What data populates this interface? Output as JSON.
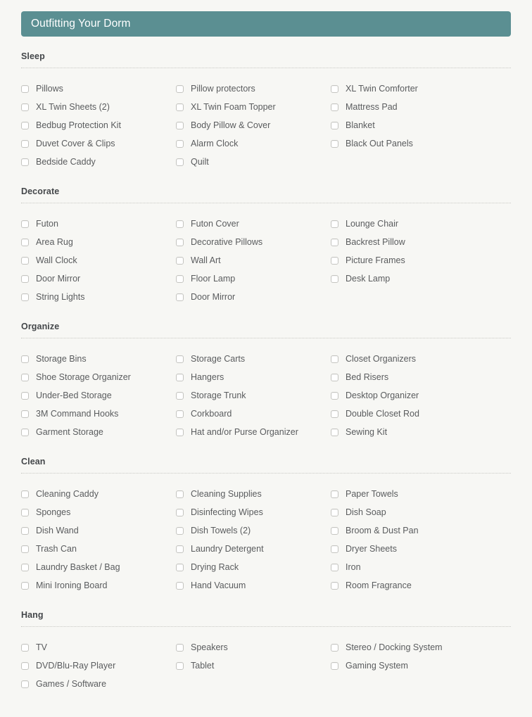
{
  "header": {
    "title": "Outfitting Your Dorm",
    "accent_color": "#5b8f92",
    "text_color": "#ffffff"
  },
  "page": {
    "background_color": "#f7f7f4",
    "label_color": "#5a5c5e",
    "section_heading_color": "#44474a",
    "checkbox_border_color": "#c4c4c0",
    "divider_color": "#c9c9c4"
  },
  "sections": [
    {
      "heading": "Sleep",
      "columns": [
        [
          "Pillows",
          "XL Twin Sheets (2)",
          "Bedbug Protection Kit",
          "Duvet Cover & Clips",
          "Bedside Caddy"
        ],
        [
          "Pillow protectors",
          "XL Twin Foam Topper",
          "Body Pillow & Cover",
          "Alarm Clock",
          "Quilt"
        ],
        [
          "XL Twin Comforter",
          "Mattress Pad",
          "Blanket",
          "Black Out Panels"
        ]
      ]
    },
    {
      "heading": "Decorate",
      "columns": [
        [
          "Futon",
          "Area Rug",
          "Wall Clock",
          "Door Mirror",
          "String Lights"
        ],
        [
          "Futon Cover",
          "Decorative Pillows",
          "Wall Art",
          "Floor Lamp",
          "Door Mirror"
        ],
        [
          "Lounge Chair",
          "Backrest Pillow",
          "Picture Frames",
          "Desk Lamp"
        ]
      ]
    },
    {
      "heading": "Organize",
      "columns": [
        [
          "Storage Bins",
          "Shoe Storage Organizer",
          "Under-Bed Storage",
          "3M Command Hooks",
          "Garment Storage"
        ],
        [
          "Storage Carts",
          "Hangers",
          "Storage Trunk",
          "Corkboard",
          "Hat and/or Purse Organizer"
        ],
        [
          "Closet Organizers",
          "Bed Risers",
          "Desktop Organizer",
          "Double Closet Rod",
          "Sewing Kit"
        ]
      ]
    },
    {
      "heading": "Clean",
      "columns": [
        [
          "Cleaning Caddy",
          "Sponges",
          "Dish Wand",
          "Trash Can",
          "Laundry Basket / Bag",
          "Mini Ironing Board"
        ],
        [
          "Cleaning Supplies",
          "Disinfecting Wipes",
          "Dish Towels (2)",
          "Laundry Detergent",
          "Drying Rack",
          "Hand Vacuum"
        ],
        [
          "Paper Towels",
          "Dish Soap",
          "Broom & Dust Pan",
          "Dryer Sheets",
          "Iron",
          "Room Fragrance"
        ]
      ]
    },
    {
      "heading": "Hang",
      "columns": [
        [
          "TV",
          "DVD/Blu-Ray Player",
          "Games / Software"
        ],
        [
          "Speakers",
          "Tablet"
        ],
        [
          "Stereo / Docking System",
          "Gaming System"
        ]
      ]
    }
  ]
}
